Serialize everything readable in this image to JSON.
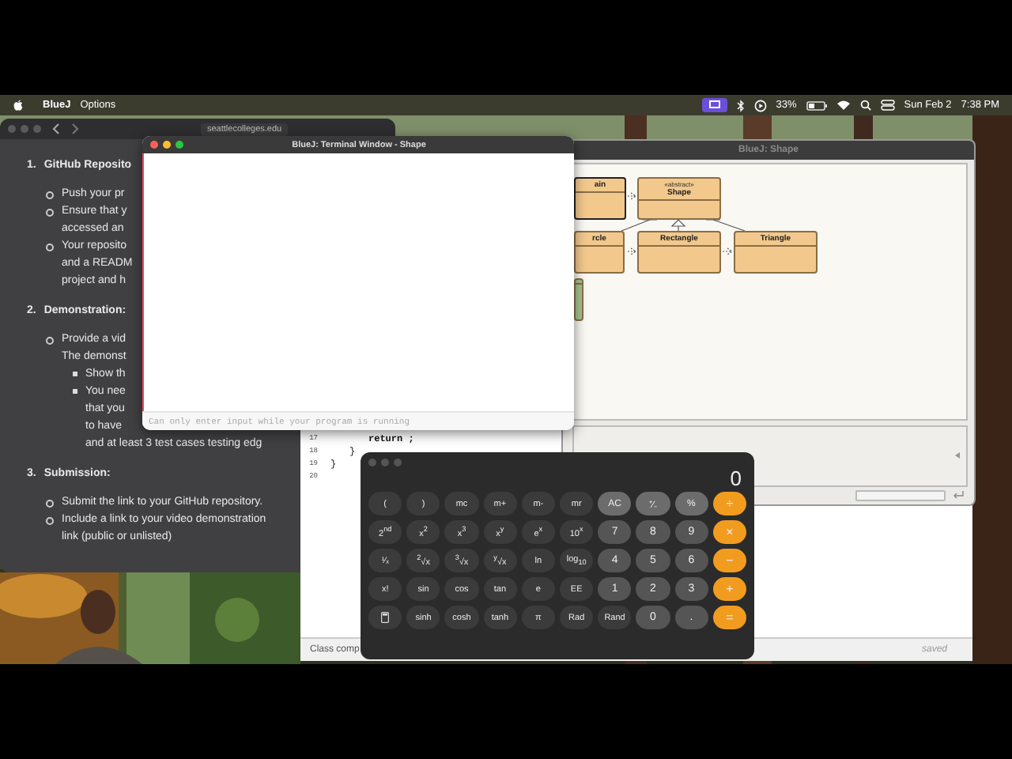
{
  "menubar": {
    "app_name": "BlueJ",
    "menus": [
      "Options"
    ],
    "battery": "33%",
    "date": "Sun Feb 2",
    "time": "7:38 PM"
  },
  "browser": {
    "url": "seattlecolleges.edu",
    "sections": [
      {
        "number": "1.",
        "title": "GitHub Reposito",
        "items": [
          {
            "lines": [
              "Push your pr"
            ]
          },
          {
            "lines": [
              "Ensure that y",
              "accessed an"
            ]
          },
          {
            "lines": [
              "Your reposito",
              "and a READM",
              "project and h"
            ]
          }
        ]
      },
      {
        "number": "2.",
        "title": "Demonstration:",
        "items": [
          {
            "lines": [
              "Provide a vid",
              "The demonst"
            ],
            "children": [
              {
                "lines": [
                  "Show th"
                ]
              },
              {
                "lines": [
                  "You nee",
                  "that you",
                  "to have",
                  "and at least 3 test cases testing edg"
                ]
              }
            ]
          }
        ]
      },
      {
        "number": "3.",
        "title": "Submission:",
        "items": [
          {
            "lines": [
              "Submit the link to your GitHub repository."
            ]
          },
          {
            "lines": [
              "Include a link to your video demonstration",
              "link (public or unlisted)"
            ]
          }
        ]
      }
    ]
  },
  "editor": {
    "lines": [
      {
        "number": "17",
        "code": "return ;"
      },
      {
        "number": "18",
        "code": "}"
      },
      {
        "number": "19",
        "code": "}"
      },
      {
        "number": "20"
      }
    ],
    "status": "Class comp",
    "save_state": "saved"
  },
  "class_window": {
    "title": "BlueJ: Shape",
    "classes": [
      {
        "name": "ain",
        "selected": true,
        "color": "#f2c88c"
      },
      {
        "name": "Shape",
        "stereotype": "«abstract»",
        "selected": false,
        "color": "#f2c88c"
      },
      {
        "name": "rcle",
        "selected": false,
        "color": "#f2c88c"
      },
      {
        "name": "Rectangle",
        "selected": false,
        "color": "#f2c88c"
      },
      {
        "name": "Triangle",
        "selected": false,
        "color": "#f2c88c"
      },
      {
        "selected": false,
        "color": "#a6c48f"
      }
    ]
  },
  "terminal": {
    "title": "BlueJ: Terminal Window - Shape",
    "placeholder": "Can only enter input while your program is running"
  },
  "calculator": {
    "display": "0",
    "buttons": [
      {
        "label": "(",
        "kind": "fn"
      },
      {
        "label": ")",
        "kind": "fn"
      },
      {
        "label": "mc",
        "kind": "fn"
      },
      {
        "label": "m+",
        "kind": "fn"
      },
      {
        "label": "m-",
        "kind": "fn"
      },
      {
        "label": "mr",
        "kind": "fn"
      },
      {
        "label": "AC",
        "kind": "top"
      },
      {
        "label": "⁺∕₋",
        "kind": "top"
      },
      {
        "label": "%",
        "kind": "top"
      },
      {
        "label": "÷",
        "kind": "op"
      },
      {
        "label": "2$^{nd}$",
        "kind": "fn"
      },
      {
        "label": "x$^{2}$",
        "kind": "fn"
      },
      {
        "label": "x$^{3}$",
        "kind": "fn"
      },
      {
        "label": "x$^{y}$",
        "kind": "fn"
      },
      {
        "label": "e$^{x}$",
        "kind": "fn"
      },
      {
        "label": "10$^{x}$",
        "kind": "fn"
      },
      {
        "label": "7",
        "kind": "digit"
      },
      {
        "label": "8",
        "kind": "digit"
      },
      {
        "label": "9",
        "kind": "digit"
      },
      {
        "label": "×",
        "kind": "op"
      },
      {
        "label": "¹⁄ₓ",
        "kind": "fn"
      },
      {
        "label": "$^{2}$√x",
        "kind": "fn"
      },
      {
        "label": "$^{3}$√x",
        "kind": "fn"
      },
      {
        "label": "$^{y}$√x",
        "kind": "fn"
      },
      {
        "label": "ln",
        "kind": "fn"
      },
      {
        "label": "log$_{10}$",
        "kind": "fn"
      },
      {
        "label": "4",
        "kind": "digit"
      },
      {
        "label": "5",
        "kind": "digit"
      },
      {
        "label": "6",
        "kind": "digit"
      },
      {
        "label": "−",
        "kind": "op"
      },
      {
        "label": "x!",
        "kind": "fn"
      },
      {
        "label": "sin",
        "kind": "fn"
      },
      {
        "label": "cos",
        "kind": "fn"
      },
      {
        "label": "tan",
        "kind": "fn"
      },
      {
        "label": "e",
        "kind": "fn"
      },
      {
        "label": "EE",
        "kind": "fn"
      },
      {
        "label": "1",
        "kind": "digit"
      },
      {
        "label": "2",
        "kind": "digit"
      },
      {
        "label": "3",
        "kind": "digit"
      },
      {
        "label": "+",
        "kind": "op"
      },
      {
        "kind": "icon"
      },
      {
        "label": "sinh",
        "kind": "fn"
      },
      {
        "label": "cosh",
        "kind": "fn"
      },
      {
        "label": "tanh",
        "kind": "fn"
      },
      {
        "label": "π",
        "kind": "fn"
      },
      {
        "label": "Rad",
        "kind": "fn"
      },
      {
        "label": "Rand",
        "kind": "fn"
      },
      {
        "label": "0",
        "kind": "digit"
      },
      {
        "label": ".",
        "kind": "digit"
      },
      {
        "label": "=",
        "kind": "op"
      }
    ]
  }
}
